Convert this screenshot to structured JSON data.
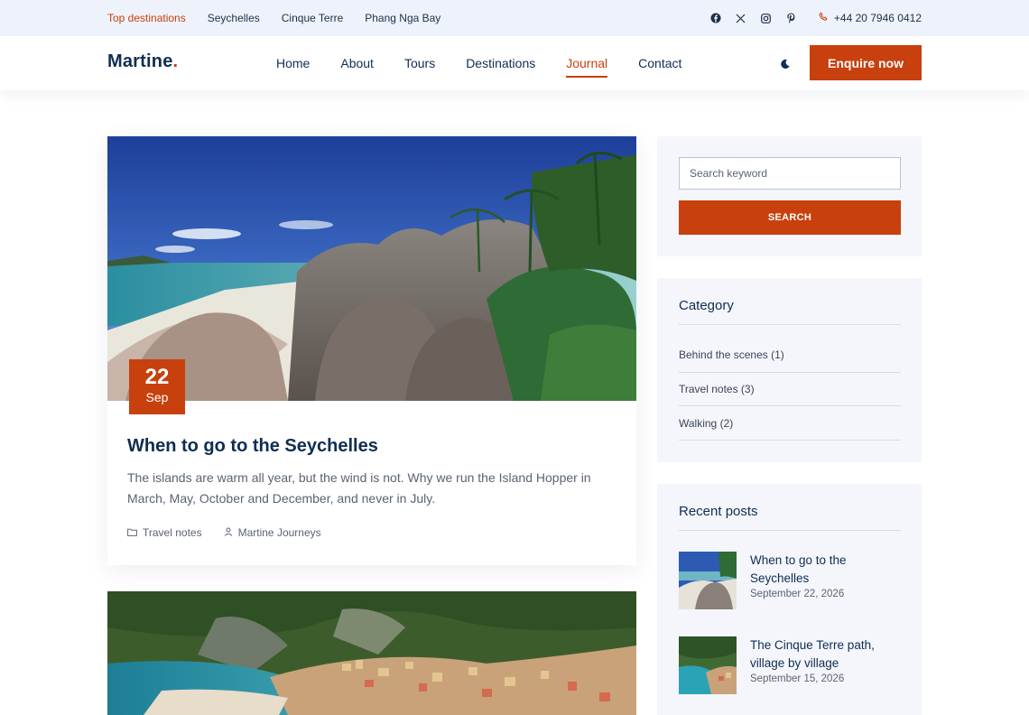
{
  "topbar": {
    "links": [
      "Top destinations",
      "Seychelles",
      "Cinque Terre",
      "Phang Nga Bay"
    ],
    "social_icons": [
      "facebook-icon",
      "x-icon",
      "instagram-icon",
      "pinterest-icon"
    ],
    "phone": "+44 20 7946 0412"
  },
  "header": {
    "logo": "Martine",
    "logo_dot": ".",
    "nav": [
      "Home",
      "About",
      "Tours",
      "Destinations",
      "Journal",
      "Contact"
    ],
    "active_nav": "Journal",
    "cta": "Enquire now"
  },
  "article": {
    "day": "22",
    "month": "Sep",
    "title": "When to go to the Seychelles",
    "excerpt": "The islands are warm all year, but the wind is not. Why we run the Island Hopper in March, May, October and December, and never in July.",
    "category": "Travel notes",
    "author": "Martine Journeys"
  },
  "sidebar": {
    "search_placeholder": "Search keyword",
    "search_button": "SEARCH",
    "category_title": "Category",
    "categories": [
      "Behind the scenes (1)",
      "Travel notes (3)",
      "Walking (2)"
    ],
    "recent_title": "Recent posts",
    "recent_posts": [
      {
        "title": "When to go to the Seychelles",
        "date": "September 22, 2026"
      },
      {
        "title": "The Cinque Terre path, village by village",
        "date": "September 15, 2026"
      }
    ]
  },
  "colors": {
    "accent": "#c7400d",
    "navy": "#0f2d52",
    "panel": "#f4f6fc"
  }
}
